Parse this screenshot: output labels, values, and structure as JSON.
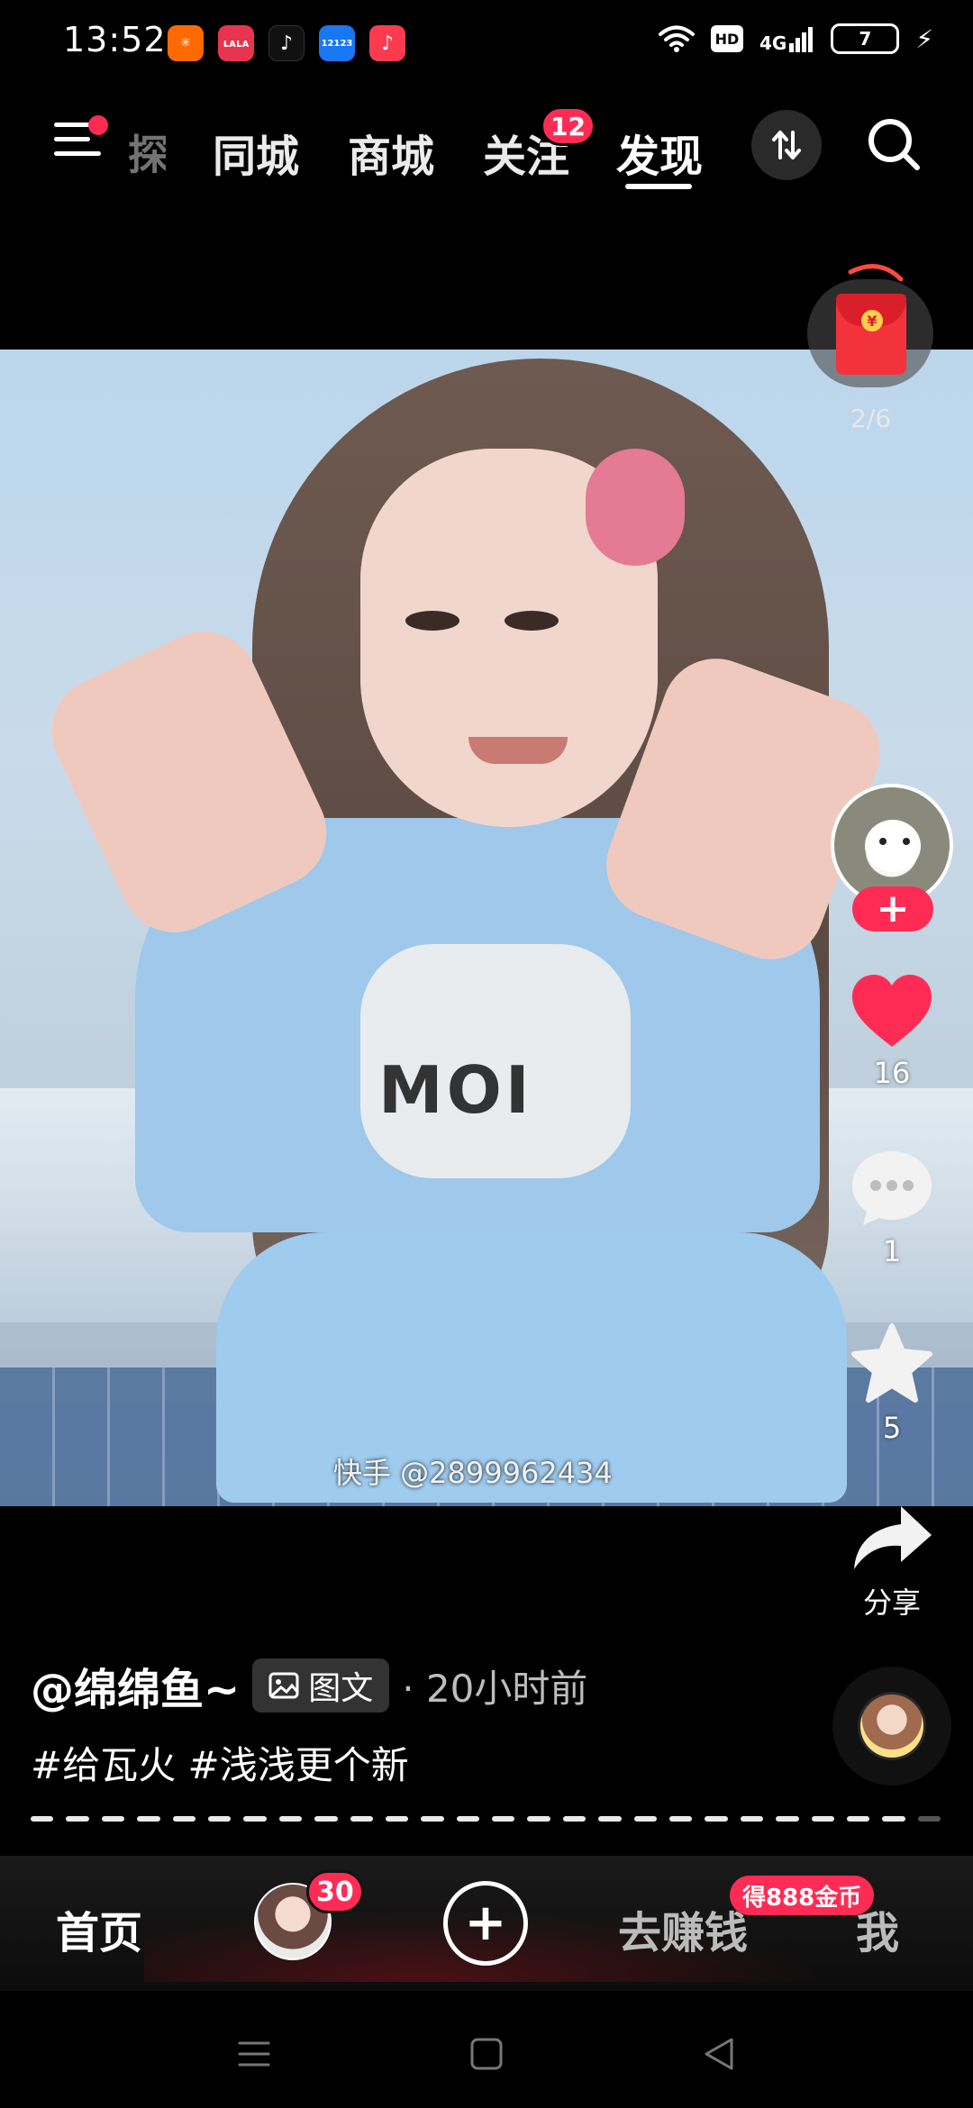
{
  "status_bar": {
    "time": "13:52",
    "apps": [
      {
        "name": "app-icon-1",
        "color": "#ff6a00",
        "glyph": "✳"
      },
      {
        "name": "app-icon-2",
        "color": "#e8344e",
        "glyph": "ʟᴀʟᴀ"
      },
      {
        "name": "app-icon-3",
        "color": "#111111",
        "glyph": "♪"
      },
      {
        "name": "app-icon-4",
        "color": "#1877f2",
        "glyph": "12123"
      },
      {
        "name": "app-icon-5",
        "color": "#fe3b4e",
        "glyph": "♪"
      }
    ],
    "hd_label": "HD",
    "network": "4G",
    "battery": "7"
  },
  "top_nav": {
    "faded_tab": "探索",
    "tabs": [
      "同城",
      "商城",
      "关注",
      "发现"
    ],
    "active_tab": "发现",
    "follow_badge": "12"
  },
  "video": {
    "shirt_text": "MOI",
    "watermark": "快手 @2899962434"
  },
  "right_rail": {
    "redpacket_coin": "¥",
    "redpacket_progress": "2/6",
    "like_count": "16",
    "comment_count": "1",
    "favorite_count": "5",
    "share_label": "分享",
    "follow_plus": "+"
  },
  "info": {
    "author": "@绵绵鱼~",
    "content_type": "图文",
    "time_ago": "· 20小时前",
    "hashtags": "#给瓦火 #浅浅更个新",
    "progress_total": 26,
    "progress_current": 26
  },
  "tab_bar": {
    "home": "首页",
    "friend_badge": "30",
    "create": "+",
    "earn": "去赚钱",
    "earn_badge": "得888金币",
    "me": "我"
  },
  "colors": {
    "accent": "#fe2c55",
    "background": "#000000"
  }
}
